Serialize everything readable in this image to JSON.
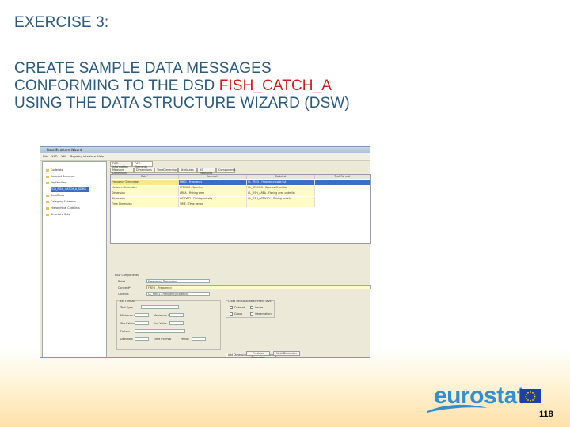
{
  "slide": {
    "heading": "EXERCISE 3:",
    "line1": "CREATE SAMPLE DATA MESSAGES",
    "line2_prefix": "CONFORMING TO THE DSD ",
    "line2_highlight": "FISH_CATCH_A",
    "line3": "USING THE DATA STRUCTURE WIZARD (DSW)",
    "page_number": "118",
    "logo_text": "eurostat",
    "colors": {
      "title": "#2b5a7c",
      "highlight": "#d11a1a",
      "logo": "#2f8fd0"
    }
  },
  "window": {
    "title": "Data Structure Wizard",
    "menu": [
      "File",
      "XSD",
      "XML",
      "Registry Interface",
      "Help"
    ],
    "tree": [
      {
        "label": "Codelists"
      },
      {
        "label": "Concept Schemes"
      },
      {
        "label": "Keyfamilies"
      },
      {
        "label": "ECB_FISH_CATCH_A_SDMX"
      },
      {
        "label": "Dataflows"
      },
      {
        "label": "Category Schemes"
      },
      {
        "label": "Hierarchical Codelists"
      },
      {
        "label": "Structure Sets"
      }
    ],
    "tabs": [
      "DSD Information",
      "DSD Elements"
    ],
    "subtabs": [
      "Measure Dimension",
      "Dimensions",
      "TimeDimension",
      "Attributes",
      "XS Measures",
      "Components"
    ],
    "grid_headers": [
      "Role*",
      "Concept*",
      "Codelist",
      "Text Format"
    ],
    "grid_rows": [
      {
        "role": "Frequency Dimension",
        "concept": "FREQ - Frequency",
        "codelist": "CL_FREQ - Frequency code list",
        "text": ""
      },
      {
        "role": "Measure Dimension",
        "concept": "SPECIES - Species",
        "codelist": "CL_SPECIES - Species Checklist",
        "text": ""
      },
      {
        "role": "Dimension",
        "concept": "AREA - Fishing area",
        "codelist": "CL_FISH_AREA - Fishing area code list",
        "text": ""
      },
      {
        "role": "Dimension",
        "concept": "ACTIVITY - Fishing activity",
        "codelist": "CL_FISH_ACTIVITY - Fishing activity",
        "text": ""
      },
      {
        "role": "Time Dimension",
        "concept": "TIME - Time period",
        "codelist": "",
        "text": ""
      }
    ],
    "form": {
      "group_label": "DSD Components",
      "role_label": "Role*",
      "role_value": "Frequency Dimension",
      "concept_label": "Concept*",
      "concept_value": "FREQ - Frequency",
      "codelist_label": "Codelist",
      "codelist_value": "CL_FREQ - Frequency code list",
      "text_format_label": "Text Format",
      "text_type_label": "Text Type",
      "min_length_label": "Minimum Length",
      "max_length_label": "Maximum Length",
      "start_value_label": "Start Value",
      "end_value_label": "End Value",
      "decimals_label": "Decimals",
      "pattern_label": "Pattern",
      "interval_label": "Interval",
      "time_interval_label": "Time Interval",
      "period_label": "Period",
      "cross_section_label": "Cross sectional attachment level",
      "checks": [
        "Dataset",
        "Series",
        "Group",
        "Observation"
      ],
      "add_button": "Add Dimension",
      "clear_button": "Clear Dimension",
      "bottom_buttons": [
        "Previous Dimension",
        "Next Dimension"
      ]
    }
  }
}
